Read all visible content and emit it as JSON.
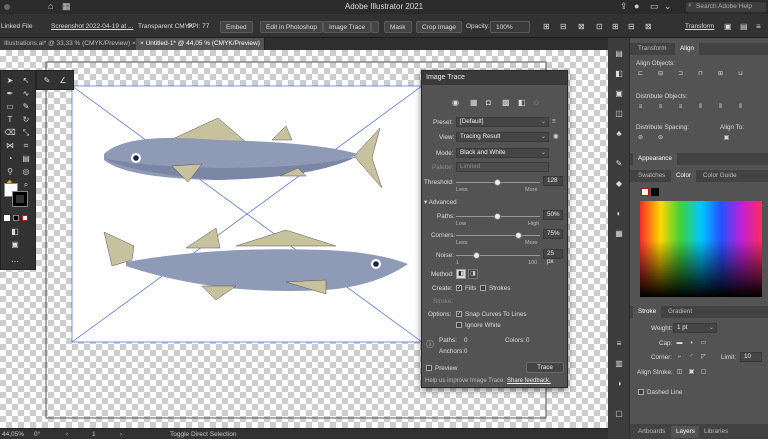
{
  "titlebar": {
    "title": "Adobe Illustrator 2021",
    "search": "Search Adobe Help"
  },
  "control_bar": {
    "linked_file": "Linked File",
    "file_name": "Screenshot 2022-04-19 at ...",
    "color_mode": "Transparent CMYK",
    "ppi": "PPI: 77",
    "embed": "Embed",
    "edit_photoshop": "Edit in Photoshop",
    "image_trace": "Image Trace",
    "mask": "Mask",
    "crop_image": "Crop Image",
    "opacity_label": "Opacity:",
    "opacity_value": "100%",
    "transform": "Transform"
  },
  "doc_tabs": [
    {
      "label": "Illustrations.ai* @ 33,33 % (CMYK/Preview)"
    },
    {
      "label": "Untitled-1* @ 44,05 % (CMYK/Preview)"
    }
  ],
  "status": {
    "zoom": "44,05%",
    "rotation": "0°",
    "page": "1",
    "tool": "Toggle Direct Selection"
  },
  "image_trace": {
    "title": "Image Trace",
    "preset_label": "Preset:",
    "preset_value": "[Default]",
    "view_label": "View:",
    "view_value": "Tracing Result",
    "mode_label": "Mode:",
    "mode_value": "Black and White",
    "palette_label": "Palette:",
    "palette_value": "Limited",
    "threshold_label": "Threshold:",
    "threshold_value": "128",
    "threshold_level": 0.5,
    "less": "Less",
    "more": "More",
    "advanced": "Advanced",
    "paths_label": "Paths:",
    "paths_value": "50%",
    "paths_level": 0.5,
    "low": "Low",
    "high": "High",
    "corners_label": "Corners:",
    "corners_value": "75%",
    "corners_level": 0.75,
    "noise_label": "Noise:",
    "noise_value": "25 px",
    "noise_min": "1",
    "noise_max": "100",
    "noise_level": 0.25,
    "method_label": "Method:",
    "create_label": "Create:",
    "fills": "Fills",
    "strokes": "Strokes",
    "stroke_label": "Stroke:",
    "options_label": "Options:",
    "snap": "Snap Curves To Lines",
    "ignore_white": "Ignore White",
    "paths_stat_label": "Paths:",
    "paths_stat": "0",
    "colors_stat_label": "Colors:",
    "colors_stat": "0",
    "anchors_stat_label": "Anchors:",
    "anchors_stat": "0",
    "preview": "Preview",
    "trace": "Trace",
    "help": "Help us improve Image Trace.",
    "feedback": "Share feedback."
  },
  "right_panel": {
    "tabs1": [
      "Transform",
      "Align"
    ],
    "align_objects": "Align Objects:",
    "distribute_objects": "Distribute Objects:",
    "distribute_spacing": "Distribute Spacing:",
    "align_to": "Align To:",
    "appearance": "Appearance",
    "color_tabs": [
      "Swatches",
      "Color",
      "Color Guide"
    ],
    "stroke_tabs": [
      "Stroke",
      "Gradient"
    ],
    "weight_label": "Weight:",
    "weight_value": "1 pt",
    "cap_label": "Cap:",
    "corner_label": "Corner:",
    "limit_label": "Limit:",
    "limit_value": "10",
    "align_stroke": "Align Stroke:",
    "dashed_line": "Dashed Line",
    "bottom_tabs": [
      "Artboards",
      "Layers",
      "Libraries"
    ]
  }
}
